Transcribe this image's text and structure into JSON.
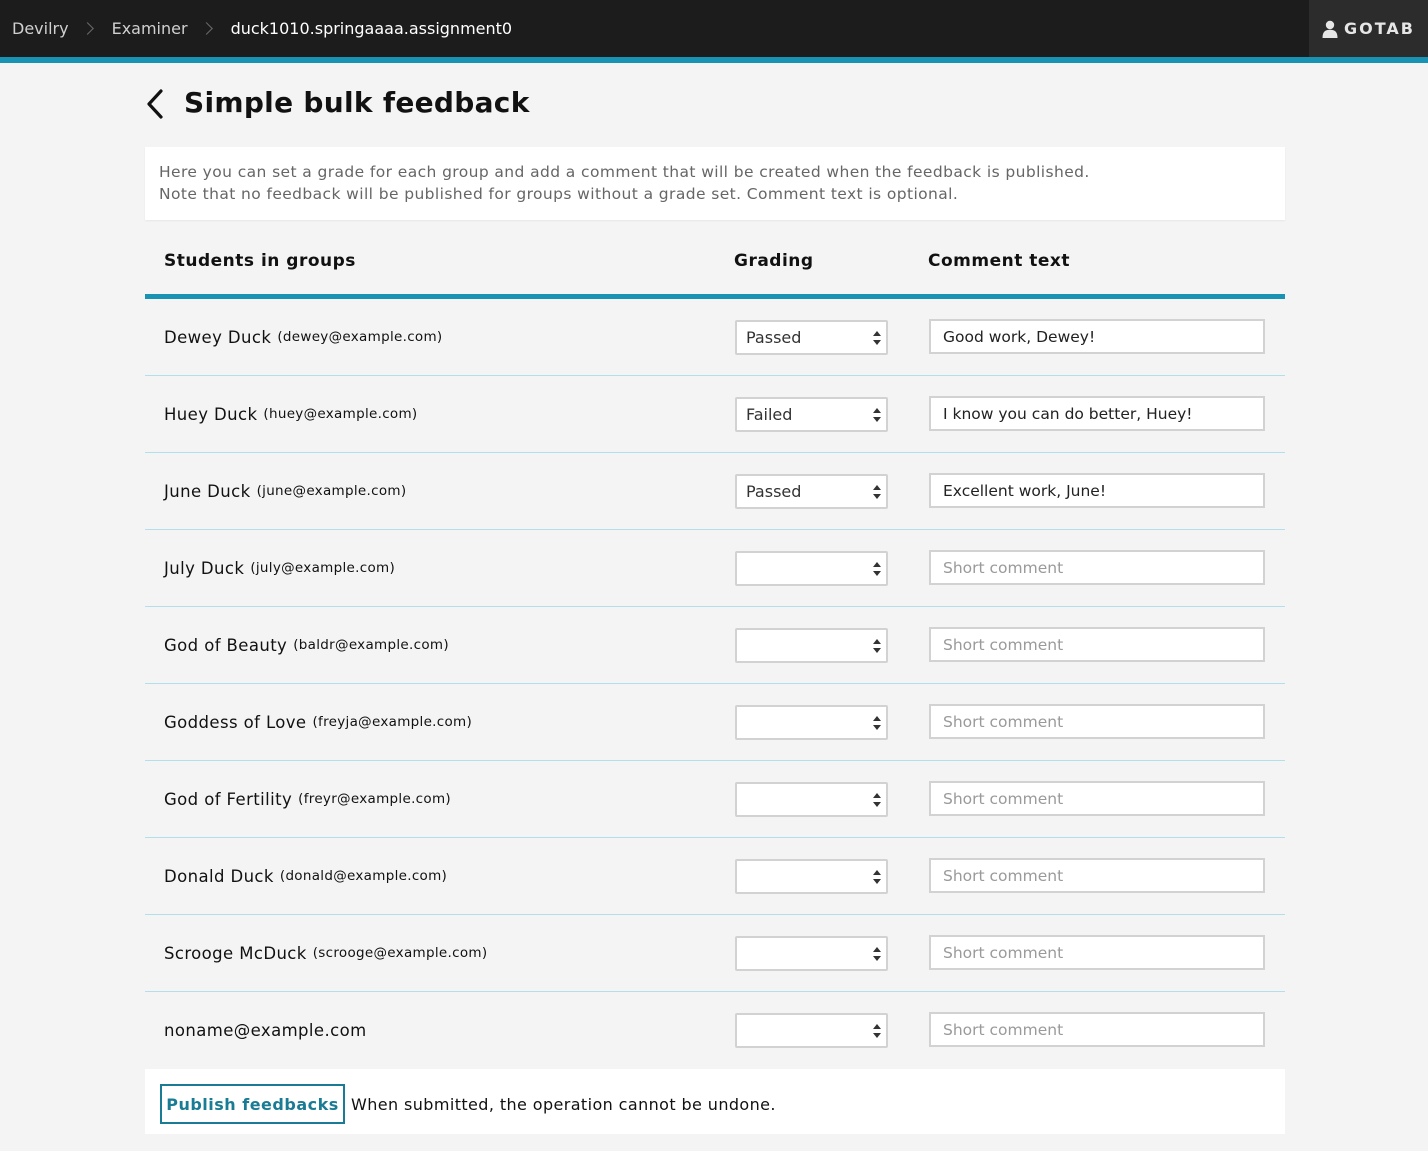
{
  "breadcrumb": [
    {
      "label": "Devilry",
      "current": false
    },
    {
      "label": "Examiner",
      "current": false
    },
    {
      "label": "duck1010.springaaaa.assignment0",
      "current": true
    }
  ],
  "user": {
    "name": "GOTAB",
    "icon": "user-icon"
  },
  "page": {
    "title": "Simple bulk feedback",
    "back_icon": "chevron-left-icon"
  },
  "info": {
    "line1": "Here you can set a grade for each group and add a comment that will be created when the feedback is published.",
    "line2": "Note that no feedback will be published for groups without a grade set. Comment text is optional."
  },
  "table": {
    "headers": [
      "Students in groups",
      "Grading",
      "Comment text"
    ],
    "comment_placeholder": "Short comment",
    "rows": [
      {
        "name": "Dewey Duck",
        "email": "(dewey@example.com)",
        "grade": "Passed",
        "comment": "Good work, Dewey!"
      },
      {
        "name": "Huey Duck",
        "email": "(huey@example.com)",
        "grade": "Failed",
        "comment": "I know you can do better, Huey!"
      },
      {
        "name": "June Duck",
        "email": "(june@example.com)",
        "grade": "Passed",
        "comment": "Excellent work, June!"
      },
      {
        "name": "July Duck",
        "email": "(july@example.com)",
        "grade": "",
        "comment": ""
      },
      {
        "name": "God of Beauty",
        "email": "(baldr@example.com)",
        "grade": "",
        "comment": ""
      },
      {
        "name": "Goddess of Love",
        "email": "(freyja@example.com)",
        "grade": "",
        "comment": ""
      },
      {
        "name": "God of Fertility",
        "email": "(freyr@example.com)",
        "grade": "",
        "comment": ""
      },
      {
        "name": "Donald Duck",
        "email": "(donald@example.com)",
        "grade": "",
        "comment": ""
      },
      {
        "name": "Scrooge McDuck",
        "email": "(scrooge@example.com)",
        "grade": "",
        "comment": ""
      },
      {
        "name": "noname@example.com",
        "email": "",
        "grade": "",
        "comment": ""
      }
    ]
  },
  "footer": {
    "publish_label": "Publish feedbacks",
    "note": "When submitted, the operation cannot be undone."
  },
  "colors": {
    "accent": "#1993b3",
    "topbar": "#1c1c1c",
    "button": "#1a7b94",
    "row_divider": "#b3dfeb"
  }
}
